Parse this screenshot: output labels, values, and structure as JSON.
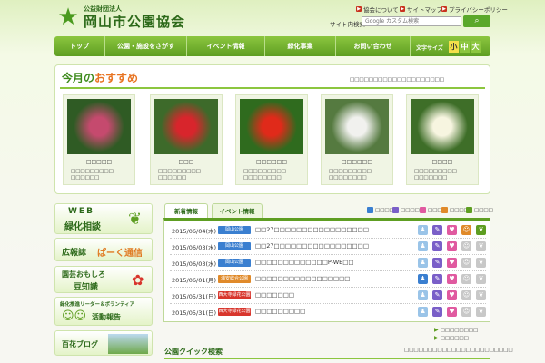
{
  "header": {
    "org_small": "公益財団法人",
    "org_name": "岡山市公園協会",
    "top_links": [
      {
        "label": "協会について"
      },
      {
        "label": "サイトマップ"
      },
      {
        "label": "プライバシーポリシー"
      }
    ],
    "search_label": "サイト内検索",
    "search_placeholder": "Google カスタム検索",
    "search_icon": "search-icon"
  },
  "nav": {
    "items": [
      {
        "label": "トップ"
      },
      {
        "label": "公園・施設をさがす"
      },
      {
        "label": "イベント情報"
      },
      {
        "label": "緑化事業"
      },
      {
        "label": "お問い合わせ"
      }
    ],
    "font_size_label": "文字サイズ",
    "font_sizes": [
      "小",
      "中",
      "大"
    ]
  },
  "recommend": {
    "title_prefix": "今月の",
    "title_main": "おすすめ",
    "note": "□□□□□□□□□□□□□□□□□□□□",
    "items": [
      {
        "name": "□□□□□",
        "desc": "□□□□□□□□□\n□□□□□□",
        "colors": [
          "#2f5b24",
          "#c54a6e"
        ]
      },
      {
        "name": "□□□",
        "desc": "□□□□□□□□□\n□□□□□□",
        "colors": [
          "#3d6a2a",
          "#d8252c"
        ]
      },
      {
        "name": "□□□□□□",
        "desc": "□□□□□□□□□\n□□□□□□□□",
        "colors": [
          "#2f6b1e",
          "#e02a1a"
        ]
      },
      {
        "name": "□□□□□□",
        "desc": "□□□□□□□□□\n□□□□□□□□",
        "colors": [
          "#557a40",
          "#f1f1ee"
        ]
      },
      {
        "name": "□□□□",
        "desc": "□□□□□□□□□\n□□□□□□□",
        "colors": [
          "#3e6e28",
          "#f7f5e0"
        ]
      }
    ]
  },
  "banners": [
    {
      "line1": "WEB",
      "line2": "緑化相談"
    },
    {
      "line1": "広報誌",
      "line2": "ぱーく通信"
    },
    {
      "line1": "園芸おもしろ",
      "line2": "豆知識"
    },
    {
      "line1": "緑化推進リーダー＆ボランティア",
      "line2": "活動報告"
    },
    {
      "line1": "百花ブログ",
      "line2": ""
    }
  ],
  "news": {
    "tabs": [
      {
        "label": "新着情報"
      },
      {
        "label": "イベント情報"
      }
    ],
    "legend": [
      {
        "label": "□□□□",
        "color": "#3a7fd0"
      },
      {
        "label": "□□□□",
        "color": "#7a5fc8"
      },
      {
        "label": "□□□",
        "color": "#e05aa0"
      },
      {
        "label": "□□□□",
        "color": "#e08a2a"
      },
      {
        "label": "□□□□",
        "color": "#5e9e22"
      }
    ],
    "rows": [
      {
        "date": "2015/06/04(木)",
        "category": "岡山公園",
        "cat_color": "#3a7fd0",
        "title": "□□27□□□□□□□□□□□□□□□□□"
      },
      {
        "date": "2015/06/03(水)",
        "category": "岡山公園",
        "cat_color": "#3a7fd0",
        "title": "□□27□□□□□□□□□□□□□□□□□"
      },
      {
        "date": "2015/06/03(水)",
        "category": "岡山公園",
        "cat_color": "#3a7fd0",
        "title": "□□□□□□□□□□□□□P-WE□□"
      },
      {
        "date": "2015/06/01(月)",
        "category": "浦安総合公園",
        "cat_color": "#e08a2a",
        "title": "□□□□□□□□□□□□□□□□□"
      },
      {
        "date": "2015/05/31(日)",
        "category": "西大寺緑花公園",
        "cat_color": "#d8352c",
        "title": "□□□□□□□"
      },
      {
        "date": "2015/05/31(日)",
        "category": "西大寺緑花公園",
        "cat_color": "#d8352c",
        "title": "□□□□□□□□□"
      }
    ],
    "more_links": [
      {
        "label": "□□□□□□□□"
      },
      {
        "label": "□□□□□□"
      }
    ]
  },
  "quick_search": {
    "title": "公園クイック検索",
    "note": "□□□□□□□□□□□□□□□□□□□□□□□"
  }
}
